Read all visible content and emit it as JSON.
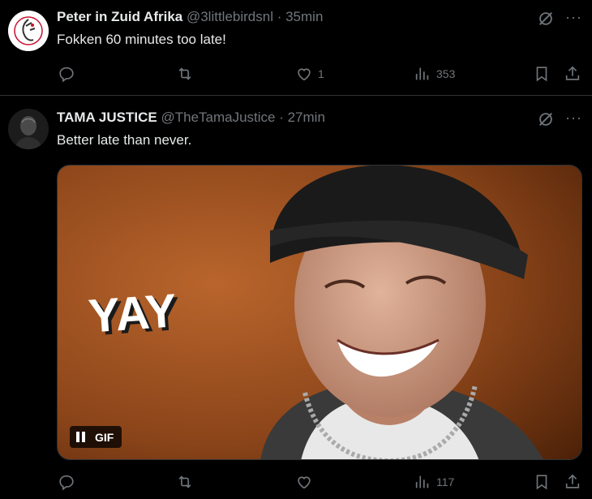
{
  "tweets": [
    {
      "name": "Peter in Zuid Afrika",
      "handle": "@3littlebirdsnl",
      "time": " · 35min",
      "text": "Fokken 60 minutes too late!",
      "actions": {
        "reply": "",
        "repost": "",
        "like": "1",
        "views": "353"
      },
      "icons": [
        "grok-icon",
        "more-icon",
        "reply-icon",
        "repost-icon",
        "like-icon",
        "views-icon",
        "bookmark-icon",
        "share-icon"
      ]
    },
    {
      "name": "TAMA JUSTICE",
      "handle": "@TheTamaJustice",
      "time": " · 27min",
      "text": "Better late than never.",
      "media": {
        "type": "gif",
        "overlay_text": "YAY",
        "badge": "GIF"
      },
      "actions": {
        "reply": "",
        "repost": "",
        "like": "",
        "views": "117"
      }
    }
  ],
  "colors": {
    "background": "#000000",
    "text": "#e7e9ea",
    "muted": "#71767b",
    "border": "#2f3336"
  }
}
